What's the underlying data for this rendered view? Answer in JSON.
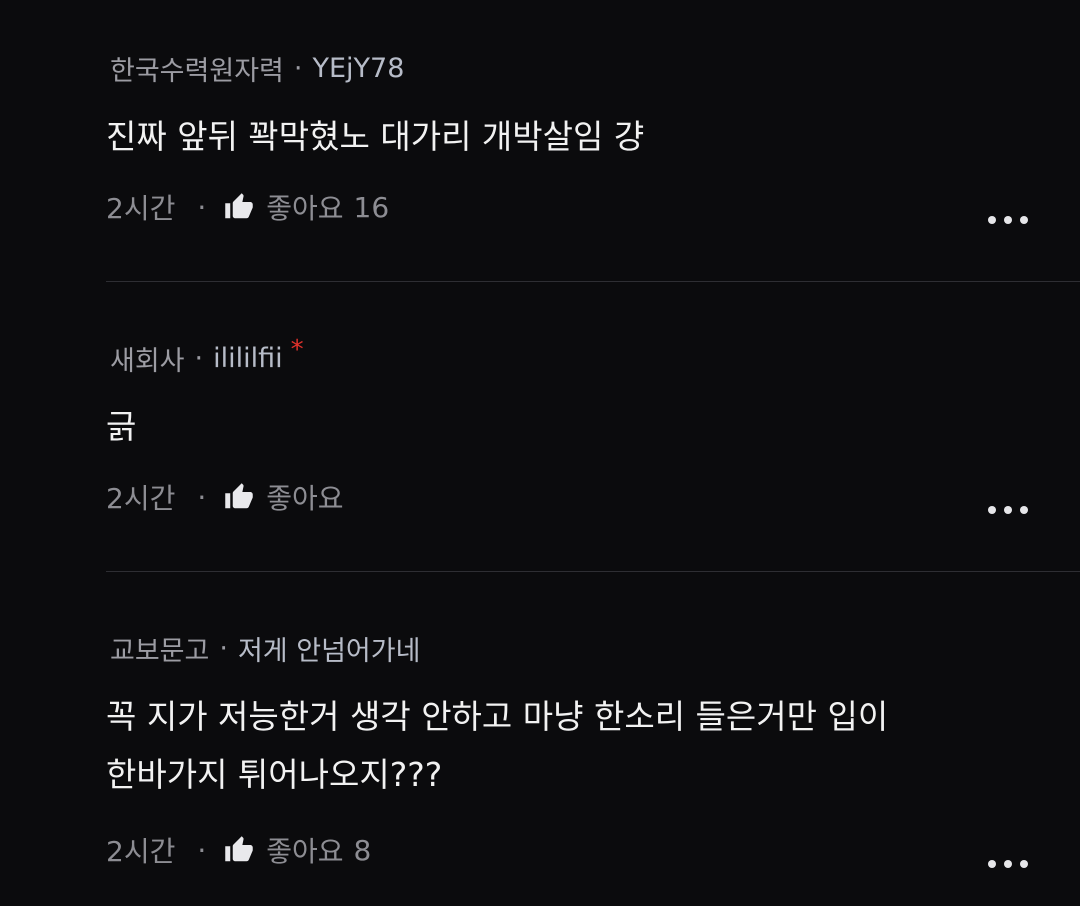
{
  "comments": [
    {
      "user": "한국수력원자력",
      "separator": "·",
      "nickname": "YEjY78",
      "text": "진짜 앞뒤 꽉막혔노 대가리 개박살임 걍",
      "time": "2시간",
      "action_separator": "·",
      "like_label": "좋아요",
      "like_count": "16"
    },
    {
      "user": "새회사",
      "separator": "·",
      "nickname": "ilililfii",
      "badge": "*",
      "text": "긁",
      "time": "2시간",
      "action_separator": "·",
      "like_label": "좋아요",
      "like_count": ""
    },
    {
      "user": "교보문고",
      "separator": "·",
      "nickname": "저게 안넘어가네",
      "text_line1": "꼭 지가 저능한거 생각 안하고 마냥 한소리 들은거만 입이",
      "text_line2": "한바가지 튀어나오지???",
      "time": "2시간",
      "action_separator": "·",
      "like_label": "좋아요",
      "like_count": "8"
    }
  ],
  "icons": {
    "like": "thumbs-up-icon",
    "more": "more-horizontal-icon"
  },
  "colors": {
    "background": "#0b0b0d",
    "text": "#f2f2f2",
    "meta": "#9c9ca3",
    "badge": "#e0312b"
  }
}
